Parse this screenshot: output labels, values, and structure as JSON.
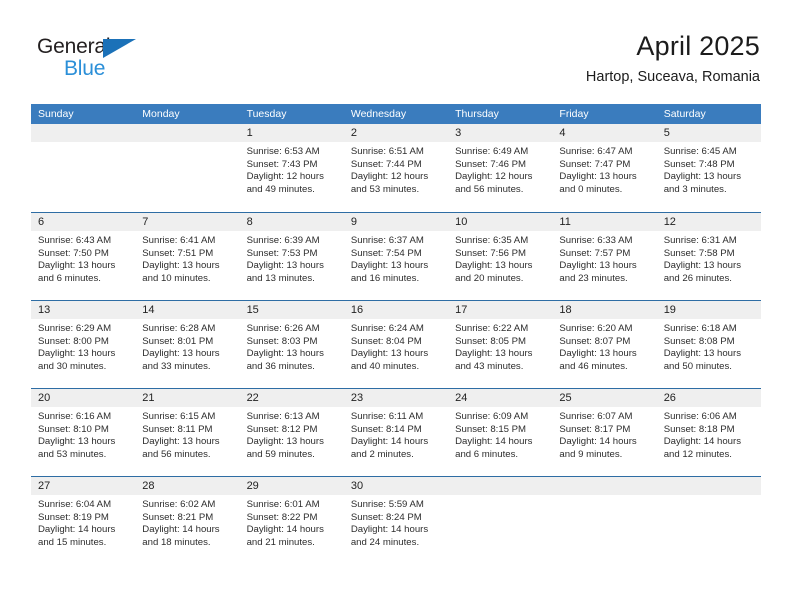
{
  "brand": {
    "name_part1": "General",
    "name_part2": "Blue",
    "triangle_icon": "triangle-logo-icon"
  },
  "header": {
    "title": "April 2025",
    "subtitle": "Hartop, Suceava, Romania"
  },
  "calendar": {
    "weekdays": [
      "Sunday",
      "Monday",
      "Tuesday",
      "Wednesday",
      "Thursday",
      "Friday",
      "Saturday"
    ],
    "colors": {
      "header_blue": "#3a7cbe",
      "row_rule_blue": "#2e6da4",
      "day_band_gray": "#efefef",
      "brand_dark": "#231f20",
      "brand_blue": "#2b8fd8"
    },
    "weeks": [
      [
        {
          "day": "",
          "lines": []
        },
        {
          "day": "",
          "lines": []
        },
        {
          "day": "1",
          "lines": [
            "Sunrise: 6:53 AM",
            "Sunset: 7:43 PM",
            "Daylight: 12 hours",
            "and 49 minutes."
          ]
        },
        {
          "day": "2",
          "lines": [
            "Sunrise: 6:51 AM",
            "Sunset: 7:44 PM",
            "Daylight: 12 hours",
            "and 53 minutes."
          ]
        },
        {
          "day": "3",
          "lines": [
            "Sunrise: 6:49 AM",
            "Sunset: 7:46 PM",
            "Daylight: 12 hours",
            "and 56 minutes."
          ]
        },
        {
          "day": "4",
          "lines": [
            "Sunrise: 6:47 AM",
            "Sunset: 7:47 PM",
            "Daylight: 13 hours",
            "and 0 minutes."
          ]
        },
        {
          "day": "5",
          "lines": [
            "Sunrise: 6:45 AM",
            "Sunset: 7:48 PM",
            "Daylight: 13 hours",
            "and 3 minutes."
          ]
        }
      ],
      [
        {
          "day": "6",
          "lines": [
            "Sunrise: 6:43 AM",
            "Sunset: 7:50 PM",
            "Daylight: 13 hours",
            "and 6 minutes."
          ]
        },
        {
          "day": "7",
          "lines": [
            "Sunrise: 6:41 AM",
            "Sunset: 7:51 PM",
            "Daylight: 13 hours",
            "and 10 minutes."
          ]
        },
        {
          "day": "8",
          "lines": [
            "Sunrise: 6:39 AM",
            "Sunset: 7:53 PM",
            "Daylight: 13 hours",
            "and 13 minutes."
          ]
        },
        {
          "day": "9",
          "lines": [
            "Sunrise: 6:37 AM",
            "Sunset: 7:54 PM",
            "Daylight: 13 hours",
            "and 16 minutes."
          ]
        },
        {
          "day": "10",
          "lines": [
            "Sunrise: 6:35 AM",
            "Sunset: 7:56 PM",
            "Daylight: 13 hours",
            "and 20 minutes."
          ]
        },
        {
          "day": "11",
          "lines": [
            "Sunrise: 6:33 AM",
            "Sunset: 7:57 PM",
            "Daylight: 13 hours",
            "and 23 minutes."
          ]
        },
        {
          "day": "12",
          "lines": [
            "Sunrise: 6:31 AM",
            "Sunset: 7:58 PM",
            "Daylight: 13 hours",
            "and 26 minutes."
          ]
        }
      ],
      [
        {
          "day": "13",
          "lines": [
            "Sunrise: 6:29 AM",
            "Sunset: 8:00 PM",
            "Daylight: 13 hours",
            "and 30 minutes."
          ]
        },
        {
          "day": "14",
          "lines": [
            "Sunrise: 6:28 AM",
            "Sunset: 8:01 PM",
            "Daylight: 13 hours",
            "and 33 minutes."
          ]
        },
        {
          "day": "15",
          "lines": [
            "Sunrise: 6:26 AM",
            "Sunset: 8:03 PM",
            "Daylight: 13 hours",
            "and 36 minutes."
          ]
        },
        {
          "day": "16",
          "lines": [
            "Sunrise: 6:24 AM",
            "Sunset: 8:04 PM",
            "Daylight: 13 hours",
            "and 40 minutes."
          ]
        },
        {
          "day": "17",
          "lines": [
            "Sunrise: 6:22 AM",
            "Sunset: 8:05 PM",
            "Daylight: 13 hours",
            "and 43 minutes."
          ]
        },
        {
          "day": "18",
          "lines": [
            "Sunrise: 6:20 AM",
            "Sunset: 8:07 PM",
            "Daylight: 13 hours",
            "and 46 minutes."
          ]
        },
        {
          "day": "19",
          "lines": [
            "Sunrise: 6:18 AM",
            "Sunset: 8:08 PM",
            "Daylight: 13 hours",
            "and 50 minutes."
          ]
        }
      ],
      [
        {
          "day": "20",
          "lines": [
            "Sunrise: 6:16 AM",
            "Sunset: 8:10 PM",
            "Daylight: 13 hours",
            "and 53 minutes."
          ]
        },
        {
          "day": "21",
          "lines": [
            "Sunrise: 6:15 AM",
            "Sunset: 8:11 PM",
            "Daylight: 13 hours",
            "and 56 minutes."
          ]
        },
        {
          "day": "22",
          "lines": [
            "Sunrise: 6:13 AM",
            "Sunset: 8:12 PM",
            "Daylight: 13 hours",
            "and 59 minutes."
          ]
        },
        {
          "day": "23",
          "lines": [
            "Sunrise: 6:11 AM",
            "Sunset: 8:14 PM",
            "Daylight: 14 hours",
            "and 2 minutes."
          ]
        },
        {
          "day": "24",
          "lines": [
            "Sunrise: 6:09 AM",
            "Sunset: 8:15 PM",
            "Daylight: 14 hours",
            "and 6 minutes."
          ]
        },
        {
          "day": "25",
          "lines": [
            "Sunrise: 6:07 AM",
            "Sunset: 8:17 PM",
            "Daylight: 14 hours",
            "and 9 minutes."
          ]
        },
        {
          "day": "26",
          "lines": [
            "Sunrise: 6:06 AM",
            "Sunset: 8:18 PM",
            "Daylight: 14 hours",
            "and 12 minutes."
          ]
        }
      ],
      [
        {
          "day": "27",
          "lines": [
            "Sunrise: 6:04 AM",
            "Sunset: 8:19 PM",
            "Daylight: 14 hours",
            "and 15 minutes."
          ]
        },
        {
          "day": "28",
          "lines": [
            "Sunrise: 6:02 AM",
            "Sunset: 8:21 PM",
            "Daylight: 14 hours",
            "and 18 minutes."
          ]
        },
        {
          "day": "29",
          "lines": [
            "Sunrise: 6:01 AM",
            "Sunset: 8:22 PM",
            "Daylight: 14 hours",
            "and 21 minutes."
          ]
        },
        {
          "day": "30",
          "lines": [
            "Sunrise: 5:59 AM",
            "Sunset: 8:24 PM",
            "Daylight: 14 hours",
            "and 24 minutes."
          ]
        },
        {
          "day": "",
          "lines": []
        },
        {
          "day": "",
          "lines": []
        },
        {
          "day": "",
          "lines": []
        }
      ]
    ]
  }
}
